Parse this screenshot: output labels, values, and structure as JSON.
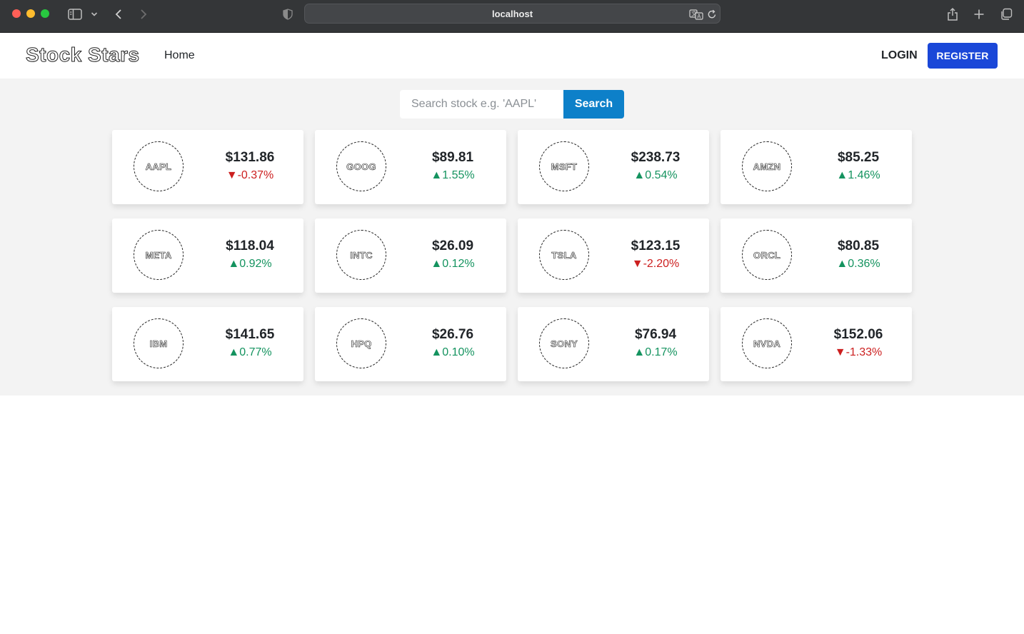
{
  "browser": {
    "url": "localhost"
  },
  "navbar": {
    "brand": "Stock Stars",
    "home_label": "Home",
    "login_label": "LOGIN",
    "register_label": "REGISTER"
  },
  "search": {
    "placeholder": "Search stock e.g. 'AAPL'",
    "value": "",
    "button_label": "Search"
  },
  "colors": {
    "register_button": "#1a47d8",
    "search_button": "#0d80c9",
    "positive": "#14935f",
    "negative": "#cc1f1f"
  },
  "stocks": [
    {
      "symbol": "AAPL",
      "price": "$131.86",
      "change": "▼-0.37%",
      "direction": "down"
    },
    {
      "symbol": "GOOG",
      "price": "$89.81",
      "change": "▲1.55%",
      "direction": "up"
    },
    {
      "symbol": "MSFT",
      "price": "$238.73",
      "change": "▲0.54%",
      "direction": "up"
    },
    {
      "symbol": "AMZN",
      "price": "$85.25",
      "change": "▲1.46%",
      "direction": "up"
    },
    {
      "symbol": "META",
      "price": "$118.04",
      "change": "▲0.92%",
      "direction": "up"
    },
    {
      "symbol": "INTC",
      "price": "$26.09",
      "change": "▲0.12%",
      "direction": "up"
    },
    {
      "symbol": "TSLA",
      "price": "$123.15",
      "change": "▼-2.20%",
      "direction": "down"
    },
    {
      "symbol": "ORCL",
      "price": "$80.85",
      "change": "▲0.36%",
      "direction": "up"
    },
    {
      "symbol": "IBM",
      "price": "$141.65",
      "change": "▲0.77%",
      "direction": "up"
    },
    {
      "symbol": "HPQ",
      "price": "$26.76",
      "change": "▲0.10%",
      "direction": "up"
    },
    {
      "symbol": "SONY",
      "price": "$76.94",
      "change": "▲0.17%",
      "direction": "up"
    },
    {
      "symbol": "NVDA",
      "price": "$152.06",
      "change": "▼-1.33%",
      "direction": "down"
    }
  ]
}
